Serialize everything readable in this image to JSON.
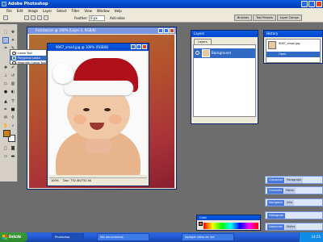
{
  "app": {
    "title": "Adobe Photoshop"
  },
  "menu": [
    "File",
    "Edit",
    "Image",
    "Layer",
    "Select",
    "Filter",
    "View",
    "Window",
    "Help"
  ],
  "options": {
    "feather_label": "Feather:",
    "feather_value": "0 px",
    "antialias_label": "Anti-alias"
  },
  "palette_well": [
    "Brushes",
    "Tool Presets",
    "Layer Comps"
  ],
  "lasso_flyout": {
    "items": [
      {
        "label": "Lasso Tool",
        "selected": false
      },
      {
        "label": "Polygonal Lasso Tool",
        "selected": true
      },
      {
        "label": "Magnetic Lasso Tool",
        "selected": false
      }
    ]
  },
  "windows": {
    "back": {
      "title": "Felicitacion @ 100% (Layer 2, RGB/8)"
    },
    "front": {
      "title": "9067_small.jpg @ 100% (RGB/8)",
      "status": "Doc: 732.4K/732.4K",
      "zoom": "100%"
    }
  },
  "layers": {
    "title": "Layers",
    "tab": "Layers",
    "row_label": "Background"
  },
  "history": {
    "title": "History",
    "snapshot_label": "9067_small.jpg",
    "step_label": "Open"
  },
  "dock_palettes": [
    {
      "tabs": [
        "Character",
        "Paragraph"
      ]
    },
    {
      "tabs": [
        "Channels",
        "Paths"
      ]
    },
    {
      "tabs": [
        "Navigator",
        "Info"
      ]
    },
    {
      "tabs": [
        "Histogram"
      ]
    },
    {
      "tabs": [
        "Swatches",
        "Styles"
      ]
    }
  ],
  "color_palette": {
    "title": "Color"
  },
  "taskbar": {
    "start_label": "Inicio",
    "tasks": [
      {
        "label": "Photoshop",
        "active": true
      },
      {
        "label": "Mis documentos",
        "active": false
      },
      {
        "label": "Agregar sitios de red",
        "active": false
      }
    ],
    "clock": "14:25"
  },
  "colors": {
    "foreground": "#c8821a",
    "background": "#ffffff"
  }
}
